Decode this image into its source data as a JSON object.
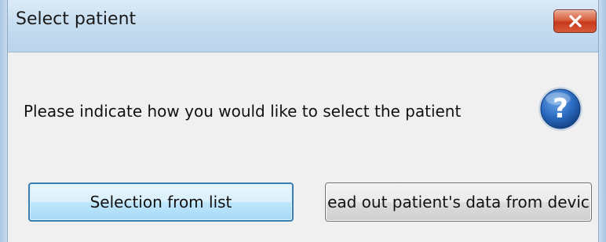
{
  "dialog": {
    "title": "Select patient",
    "close_icon": "close-x-icon",
    "message": "Please indicate how you would like to select the patient",
    "help_icon": "question-mark-icon",
    "buttons": {
      "select_from_list": "Selection from list",
      "read_from_device": "ead out patient's data from devic"
    }
  },
  "colors": {
    "titlebar": "#c8def1",
    "close_button": "#c7391c",
    "content_background": "#f0f0f0",
    "help_icon": "#1f5fae",
    "default_button_border": "#3c7fb1"
  }
}
